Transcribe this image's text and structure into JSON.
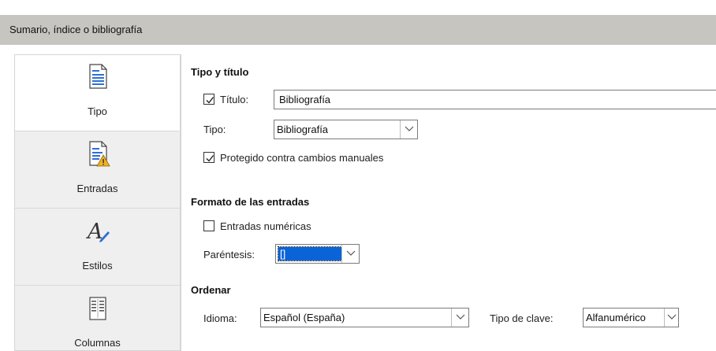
{
  "window": {
    "title": "Sumario, índice o bibliografía"
  },
  "sidebar": {
    "tabs": [
      {
        "label": "Tipo",
        "icon": "document-lines-icon",
        "active": true
      },
      {
        "label": "Entradas",
        "icon": "document-warning-icon",
        "active": false
      },
      {
        "label": "Estilos",
        "icon": "styles-pen-icon",
        "active": false
      },
      {
        "label": "Columnas",
        "icon": "columns-icon",
        "active": false
      }
    ]
  },
  "tipo_titulo": {
    "heading": "Tipo y título",
    "titulo_label": "Título:",
    "titulo_checked": true,
    "titulo_value": "Bibliografía",
    "tipo_label": "Tipo:",
    "tipo_value": "Bibliografía",
    "protegido_label": "Protegido contra cambios manuales",
    "protegido_checked": true
  },
  "formato": {
    "heading": "Formato de las entradas",
    "numericas_label": "Entradas numéricas",
    "numericas_checked": false,
    "parentesis_label": "Paréntesis:",
    "parentesis_value": "[]"
  },
  "ordenar": {
    "heading": "Ordenar",
    "idioma_label": "Idioma:",
    "idioma_value": "Español (España)",
    "tipo_clave_label": "Tipo de clave:",
    "tipo_clave_value": "Alfanumérico"
  },
  "colors": {
    "titlebar": "#c6c5c0",
    "selection": "#0a64d8",
    "warning": "#f0b323",
    "pen": "#2f6fd6"
  }
}
